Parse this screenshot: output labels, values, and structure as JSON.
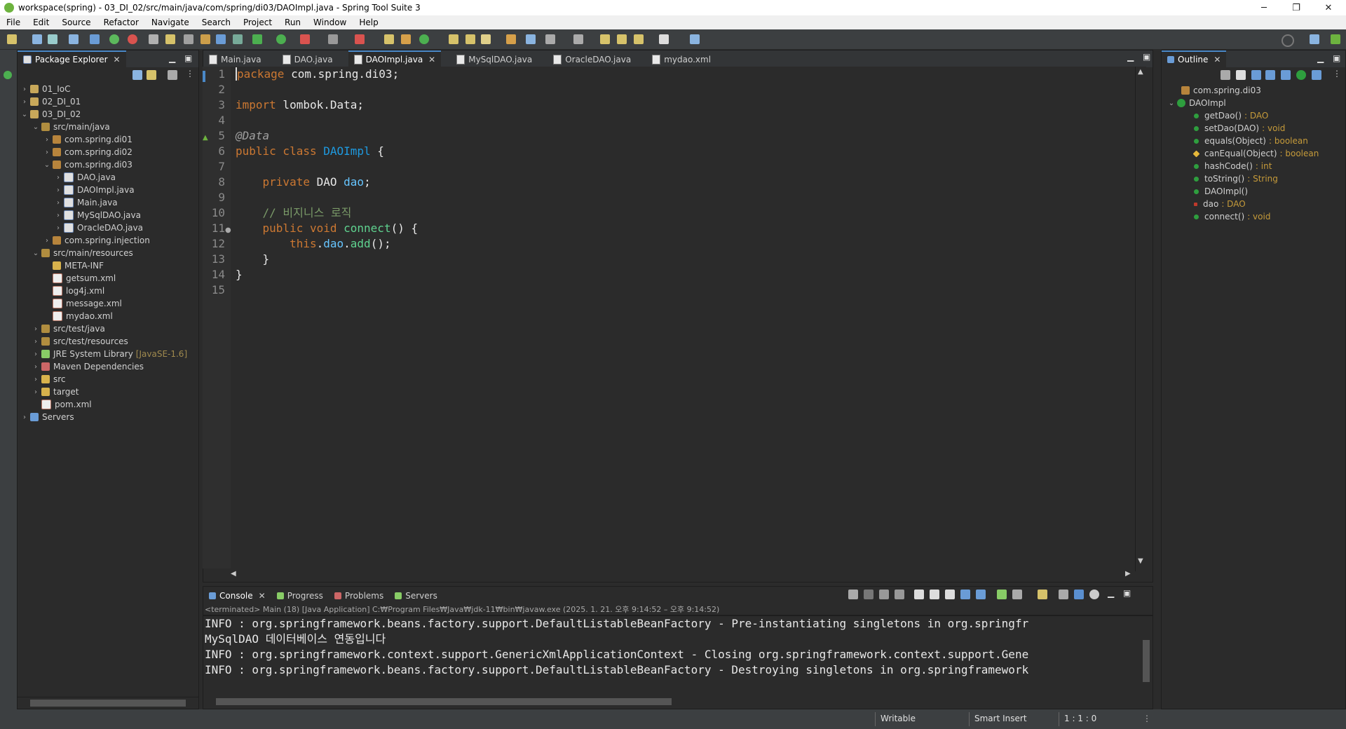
{
  "window": {
    "title": "workspace(spring) - 03_DI_02/src/main/java/com/spring/di03/DAOImpl.java - Spring Tool Suite 3",
    "controls": [
      "─",
      "❐",
      "✕"
    ]
  },
  "menu": [
    "File",
    "Edit",
    "Source",
    "Refactor",
    "Navigate",
    "Search",
    "Project",
    "Run",
    "Window",
    "Help"
  ],
  "package_explorer": {
    "title": "Package Explorer",
    "tree": [
      {
        "label": "01_IoC",
        "icon": "project-icon",
        "twisty": "›"
      },
      {
        "label": "02_DI_01",
        "icon": "project-icon",
        "twisty": "›"
      },
      {
        "label": "03_DI_02",
        "icon": "project-icon",
        "twisty": "⌄"
      },
      {
        "label": "src/main/java",
        "icon": "source-folder-icon",
        "twisty": "⌄"
      },
      {
        "label": "com.spring.di01",
        "icon": "package-icon",
        "twisty": "›"
      },
      {
        "label": "com.spring.di02",
        "icon": "package-icon",
        "twisty": "›"
      },
      {
        "label": "com.spring.di03",
        "icon": "package-icon",
        "twisty": "⌄"
      },
      {
        "label": "DAO.java",
        "icon": "java-file-icon",
        "twisty": "›"
      },
      {
        "label": "DAOImpl.java",
        "icon": "java-file-icon",
        "twisty": "›"
      },
      {
        "label": "Main.java",
        "icon": "java-file-icon",
        "twisty": "›"
      },
      {
        "label": "MySqlDAO.java",
        "icon": "java-file-icon",
        "twisty": "›"
      },
      {
        "label": "OracleDAO.java",
        "icon": "java-file-icon",
        "twisty": "›"
      },
      {
        "label": "com.spring.injection",
        "icon": "package-icon",
        "twisty": "›"
      },
      {
        "label": "src/main/resources",
        "icon": "source-folder-icon",
        "twisty": "⌄"
      },
      {
        "label": "META-INF",
        "icon": "folder-icon",
        "twisty": ""
      },
      {
        "label": "getsum.xml",
        "icon": "xml-file-icon",
        "twisty": ""
      },
      {
        "label": "log4j.xml",
        "icon": "xml-file-icon",
        "twisty": ""
      },
      {
        "label": "message.xml",
        "icon": "xml-file-icon",
        "twisty": ""
      },
      {
        "label": "mydao.xml",
        "icon": "xml-file-icon",
        "twisty": ""
      },
      {
        "label": "src/test/java",
        "icon": "source-folder-icon",
        "twisty": "›"
      },
      {
        "label": "src/test/resources",
        "icon": "source-folder-icon",
        "twisty": "›"
      },
      {
        "label": "JRE System Library",
        "icon": "library-icon",
        "twisty": "›",
        "decoration": "[JavaSE-1.6]"
      },
      {
        "label": "Maven Dependencies",
        "icon": "maven-icon",
        "twisty": "›"
      },
      {
        "label": "src",
        "icon": "folder-icon",
        "twisty": "›"
      },
      {
        "label": "target",
        "icon": "folder-icon",
        "twisty": "›"
      },
      {
        "label": "pom.xml",
        "icon": "xml-file-icon",
        "twisty": ""
      },
      {
        "label": "Servers",
        "icon": "servers-icon",
        "twisty": "›"
      }
    ]
  },
  "editor_tabs": [
    {
      "label": "Main.java",
      "active": false
    },
    {
      "label": "DAO.java",
      "active": false
    },
    {
      "label": "DAOImpl.java",
      "active": true
    },
    {
      "label": "MySqlDAO.java",
      "active": false
    },
    {
      "label": "OracleDAO.java",
      "active": false
    },
    {
      "label": "mydao.xml",
      "active": false
    }
  ],
  "editor": {
    "line_numbers": [
      "1",
      "2",
      "3",
      "4",
      "5",
      "6",
      "7",
      "8",
      "9",
      "10",
      "11",
      "12",
      "13",
      "14",
      "15"
    ],
    "code": {
      "l1_kw": "package",
      "l1_rest": " com.spring.di03;",
      "l3_kw": "import",
      "l3_rest": " lombok.Data;",
      "l5_ann": "@Data",
      "l6_kw": "public class",
      "l6_cls": "DAOImpl",
      "l6_rest": " {",
      "l8_kw": "private",
      "l8_type": "DAO",
      "l8_field": "dao",
      "l8_rest": ";",
      "l10_comment": "// 비지니스 로직",
      "l11_kw": "public void",
      "l11_method": "connect",
      "l11_rest": "() {",
      "l12_kw": "this",
      "l12_dot1": ".",
      "l12_field": "dao",
      "l12_dot2": ".",
      "l12_method": "add",
      "l12_rest": "();",
      "l13": "}",
      "l14": "}"
    }
  },
  "bottom_panel": {
    "tabs": [
      "Console",
      "Progress",
      "Problems",
      "Servers"
    ],
    "terminated_label": "<terminated> Main (18) [Java Application] C:₩Program Files₩Java₩jdk-11₩bin₩javaw.exe  (2025. 1. 21. 오후 9:14:52 – 오후 9:14:52)",
    "lines": [
      "INFO : org.springframework.beans.factory.support.DefaultListableBeanFactory - Pre-instantiating singletons in org.springfr",
      "MySqlDAO 데이터베이스 연동입니다",
      "INFO : org.springframework.context.support.GenericXmlApplicationContext - Closing org.springframework.context.support.Gene",
      "INFO : org.springframework.beans.factory.support.DefaultListableBeanFactory - Destroying singletons in org.springframework"
    ]
  },
  "outline": {
    "title": "Outline",
    "package": "com.spring.di03",
    "class": "DAOImpl",
    "members": [
      {
        "name": "getDao()",
        "type": ": DAO",
        "kind": "method"
      },
      {
        "name": "setDao(DAO)",
        "type": ": void",
        "kind": "method"
      },
      {
        "name": "equals(Object)",
        "type": ": boolean",
        "kind": "method"
      },
      {
        "name": "canEqual(Object)",
        "type": ": boolean",
        "kind": "protected"
      },
      {
        "name": "hashCode()",
        "type": ": int",
        "kind": "method"
      },
      {
        "name": "toString()",
        "type": ": String",
        "kind": "method"
      },
      {
        "name": "DAOImpl()",
        "type": "",
        "kind": "method"
      },
      {
        "name": "dao",
        "type": ": DAO",
        "kind": "field"
      },
      {
        "name": "connect()",
        "type": ": void",
        "kind": "method"
      }
    ]
  },
  "status_bar": {
    "writable": "Writable",
    "insert_mode": "Smart Insert",
    "position": "1 : 1 : 0"
  },
  "colors": {
    "editor_bg": "#2b2b2b",
    "keyword": "#cc7832",
    "class_name": "#1e9ae0",
    "method": "#5fd28f",
    "comment": "#7a9a68"
  }
}
